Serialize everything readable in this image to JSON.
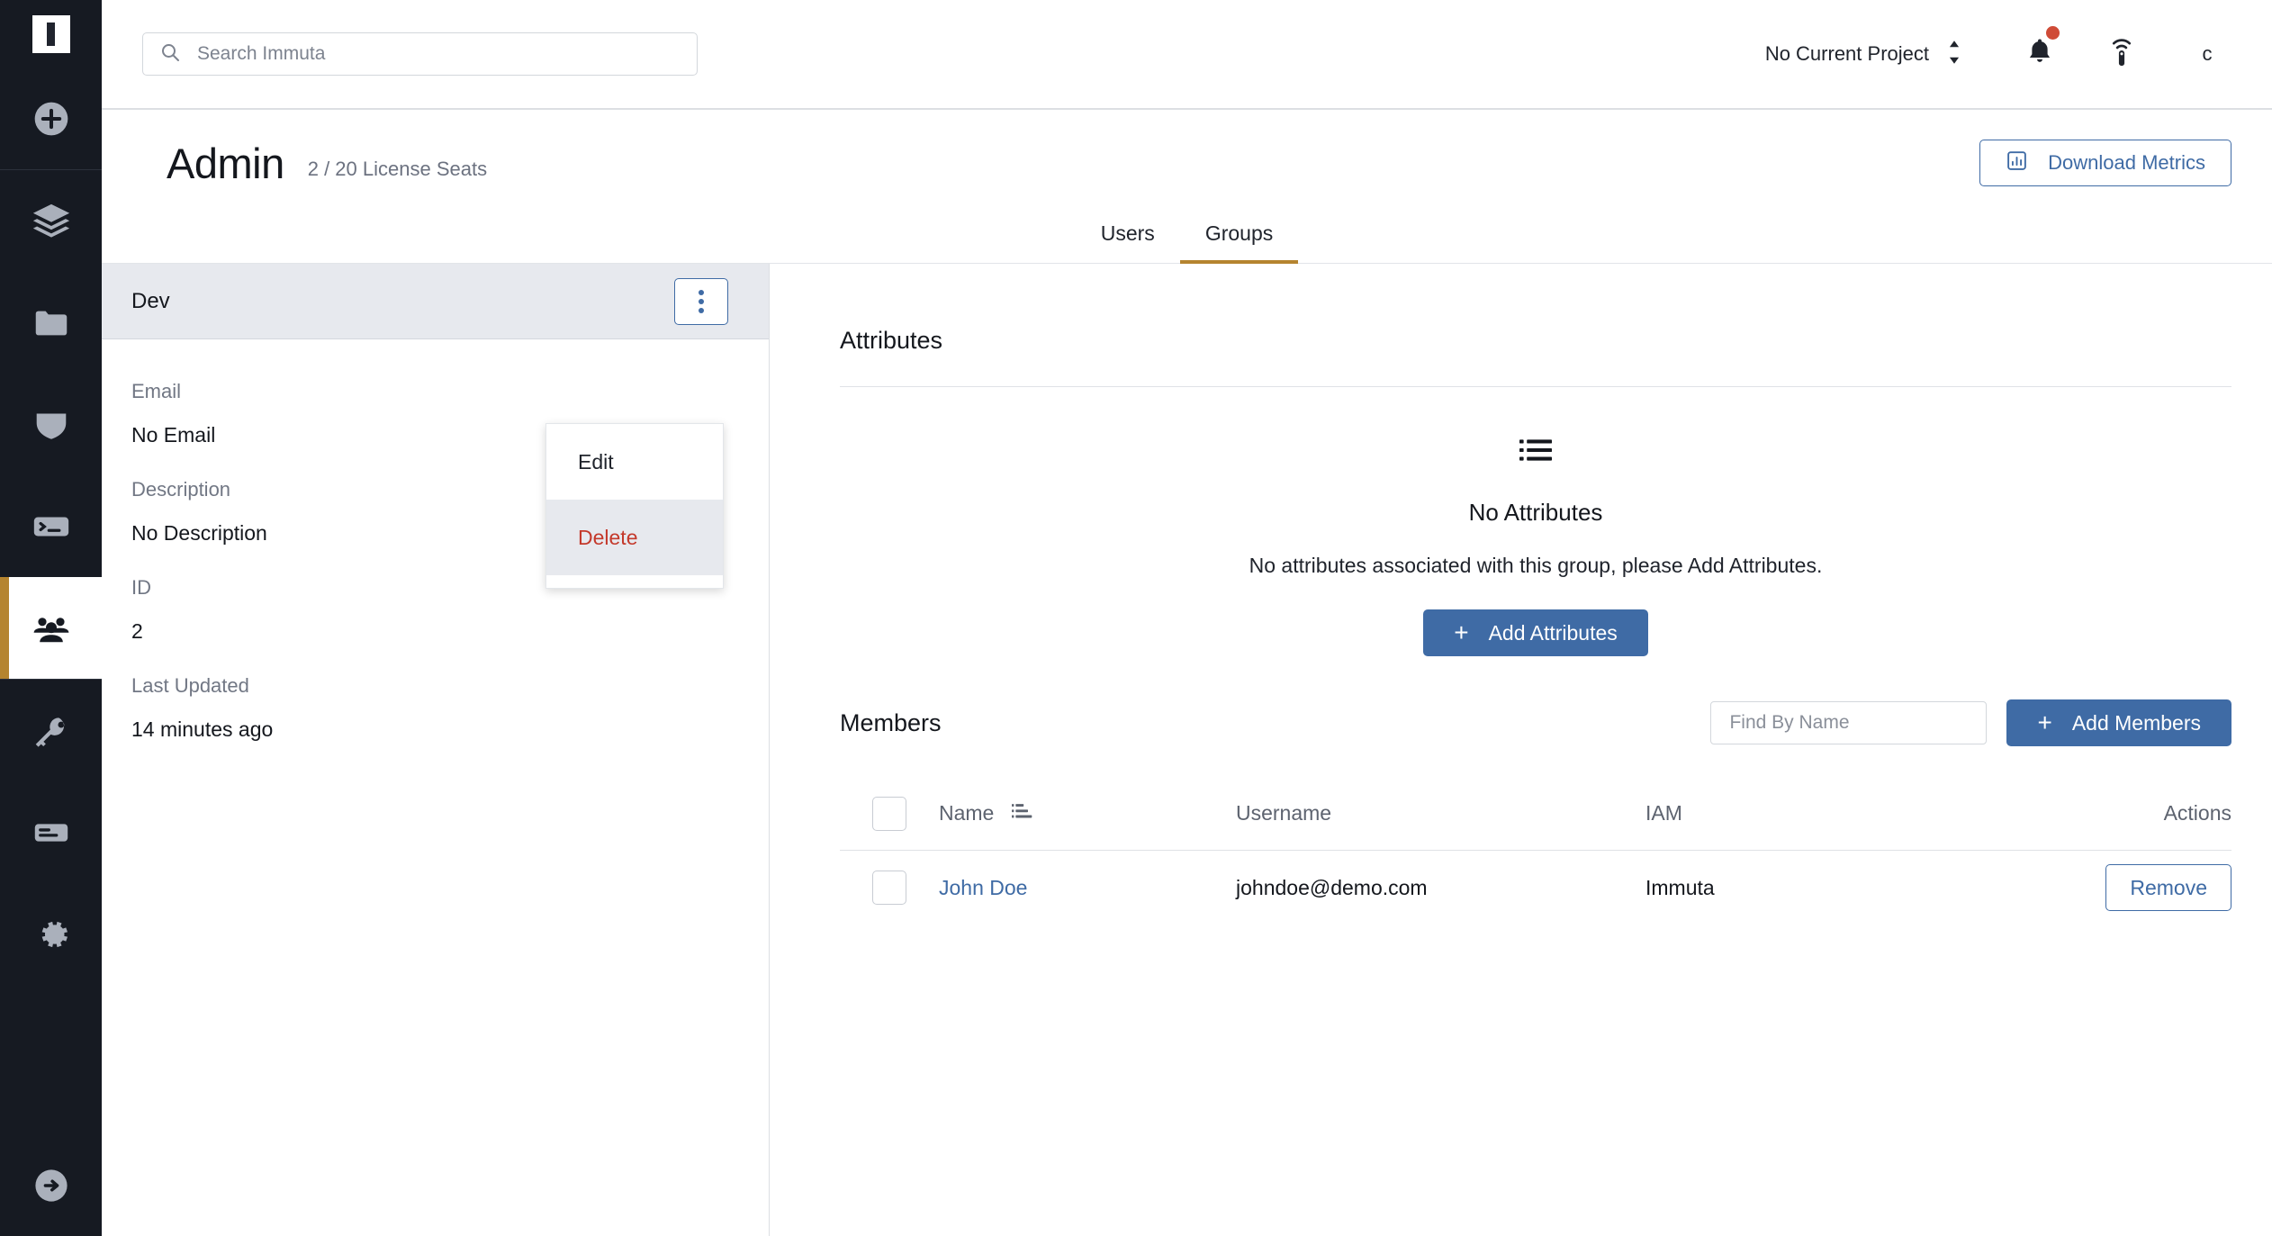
{
  "brand": {
    "logo_icon": "immuta-logo-icon",
    "accent_gold": "#b5842f",
    "accent_blue": "#3f6ba5",
    "danger_red": "#c4392b",
    "sidebar_bg": "#161a22"
  },
  "sidebar": {
    "logo_label": "Immuta",
    "items": [
      {
        "icon": "plus-circle-icon",
        "name": "add-new"
      },
      {
        "icon": "layers-icon",
        "name": "data-sources"
      },
      {
        "icon": "folder-icon",
        "name": "projects"
      },
      {
        "icon": "shield-icon",
        "name": "policies"
      },
      {
        "icon": "terminal-icon",
        "name": "query-engine"
      },
      {
        "icon": "people-icon",
        "name": "admin",
        "active": true
      },
      {
        "icon": "key-icon",
        "name": "api-keys"
      },
      {
        "icon": "document-lines-icon",
        "name": "audit"
      },
      {
        "icon": "gear-icon",
        "name": "settings"
      },
      {
        "icon": "logout-arrow-icon",
        "name": "sign-out"
      }
    ]
  },
  "header": {
    "search": {
      "placeholder": "Search Immuta",
      "value": "",
      "icon": "search-icon"
    },
    "project_selector": {
      "label": "No Current Project",
      "icon": "chevron-up-down-icon"
    },
    "notifications": {
      "icon": "bell-icon",
      "has_unread": true,
      "badge_color": "#cf4b37"
    },
    "broadcast": {
      "icon": "broadcast-icon"
    },
    "avatar": {
      "label": "c"
    }
  },
  "page": {
    "title": "Admin",
    "subtitle": "2 / 20 License Seats",
    "download_button": {
      "label": "Download Metrics",
      "icon": "bar-chart-icon"
    },
    "tabs": [
      {
        "label": "Users",
        "active": false
      },
      {
        "label": "Groups",
        "active": true
      }
    ]
  },
  "group_panel": {
    "selected_group": "Dev",
    "kebab_icon": "vertical-dots-icon",
    "menu": [
      {
        "label": "Edit",
        "variant": "normal"
      },
      {
        "label": "Delete",
        "variant": "danger"
      }
    ],
    "fields": [
      {
        "label": "Email",
        "value": "No Email"
      },
      {
        "label": "Description",
        "value": "No Description"
      },
      {
        "label": "ID",
        "value": "2"
      },
      {
        "label": "Last Updated",
        "value": "14 minutes ago"
      }
    ]
  },
  "attributes": {
    "title": "Attributes",
    "empty_icon": "bulleted-list-icon",
    "empty_title": "No Attributes",
    "empty_text": "No attributes associated with this group, please Add Attributes.",
    "add_button": {
      "label": "Add Attributes",
      "icon": "plus-icon"
    }
  },
  "members": {
    "title": "Members",
    "search": {
      "placeholder": "Find By Name",
      "value": ""
    },
    "add_button": {
      "label": "Add Members",
      "icon": "plus-icon"
    },
    "columns": {
      "name": "Name",
      "username": "Username",
      "iam": "IAM",
      "actions": "Actions",
      "sort_icon": "sort-ascending-icon"
    },
    "rows": [
      {
        "selected": false,
        "name": "John Doe",
        "username": "johndoe@demo.com",
        "iam": "Immuta",
        "action_label": "Remove"
      }
    ]
  }
}
